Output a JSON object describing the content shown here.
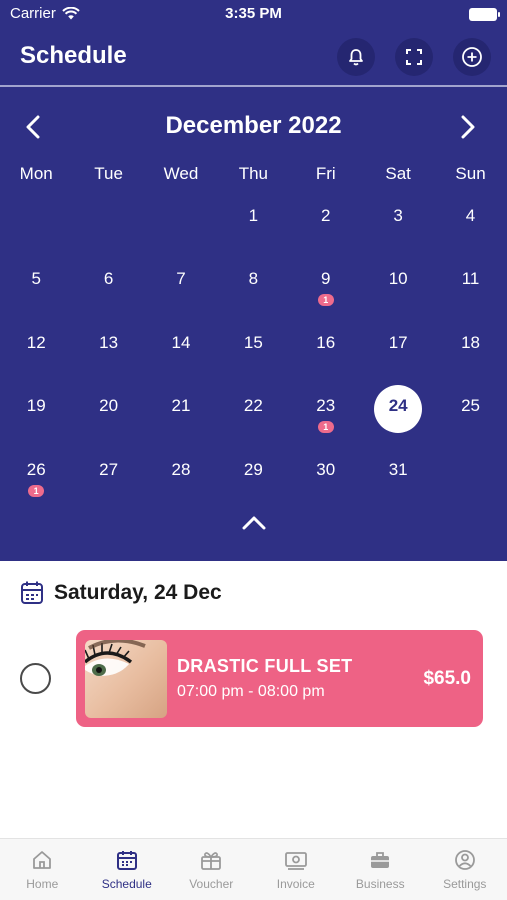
{
  "status_bar": {
    "carrier": "Carrier",
    "time": "3:35 PM"
  },
  "header": {
    "title": "Schedule",
    "actions": [
      "bell-icon",
      "scan-icon",
      "add-icon"
    ]
  },
  "calendar": {
    "month_label": "December 2022",
    "weekdays": [
      "Mon",
      "Tue",
      "Wed",
      "Thu",
      "Fri",
      "Sat",
      "Sun"
    ],
    "selected_day": "24",
    "days": [
      {
        "d": "",
        "b": ""
      },
      {
        "d": "",
        "b": ""
      },
      {
        "d": "",
        "b": ""
      },
      {
        "d": "1",
        "b": ""
      },
      {
        "d": "2",
        "b": ""
      },
      {
        "d": "3",
        "b": ""
      },
      {
        "d": "4",
        "b": ""
      },
      {
        "d": "5",
        "b": ""
      },
      {
        "d": "6",
        "b": ""
      },
      {
        "d": "7",
        "b": ""
      },
      {
        "d": "8",
        "b": ""
      },
      {
        "d": "9",
        "b": "1"
      },
      {
        "d": "10",
        "b": ""
      },
      {
        "d": "11",
        "b": ""
      },
      {
        "d": "12",
        "b": ""
      },
      {
        "d": "13",
        "b": ""
      },
      {
        "d": "14",
        "b": ""
      },
      {
        "d": "15",
        "b": ""
      },
      {
        "d": "16",
        "b": ""
      },
      {
        "d": "17",
        "b": ""
      },
      {
        "d": "18",
        "b": ""
      },
      {
        "d": "19",
        "b": ""
      },
      {
        "d": "20",
        "b": ""
      },
      {
        "d": "21",
        "b": ""
      },
      {
        "d": "22",
        "b": ""
      },
      {
        "d": "23",
        "b": "1"
      },
      {
        "d": "24",
        "b": ""
      },
      {
        "d": "25",
        "b": ""
      },
      {
        "d": "26",
        "b": "1"
      },
      {
        "d": "27",
        "b": ""
      },
      {
        "d": "28",
        "b": ""
      },
      {
        "d": "29",
        "b": ""
      },
      {
        "d": "30",
        "b": ""
      },
      {
        "d": "31",
        "b": ""
      },
      {
        "d": "",
        "b": ""
      }
    ]
  },
  "day_view": {
    "date_label": "Saturday, 24 Dec",
    "appointments": [
      {
        "service": "DRASTIC FULL SET",
        "time_range": "07:00 pm - 08:00 pm",
        "price": "$65.0"
      }
    ]
  },
  "tabs": [
    {
      "label": "Home",
      "icon": "home-icon",
      "active": false
    },
    {
      "label": "Schedule",
      "icon": "calendar-icon",
      "active": true
    },
    {
      "label": "Voucher",
      "icon": "gift-icon",
      "active": false
    },
    {
      "label": "Invoice",
      "icon": "money-icon",
      "active": false
    },
    {
      "label": "Business",
      "icon": "briefcase-icon",
      "active": false
    },
    {
      "label": "Settings",
      "icon": "profile-icon",
      "active": false
    }
  ],
  "colors": {
    "primary": "#2f3085",
    "accent": "#ee6285",
    "badge": "#ee6b8c"
  }
}
